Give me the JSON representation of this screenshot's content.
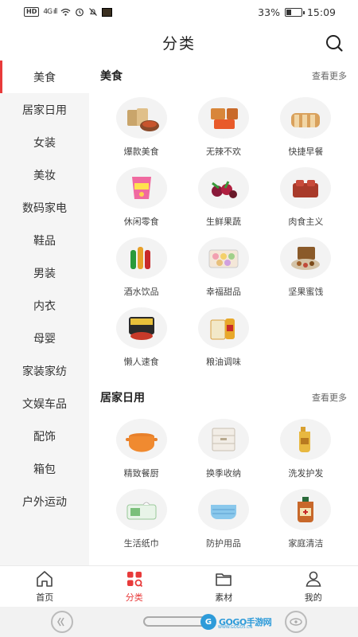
{
  "status_bar": {
    "hd": "HD",
    "signal": "4G ıll",
    "battery_percent": "33%",
    "battery_level": 0.33,
    "time": "15:09"
  },
  "header": {
    "title": "分类",
    "search_icon": "search-icon"
  },
  "sidebar": {
    "items": [
      {
        "label": "美食"
      },
      {
        "label": "居家日用"
      },
      {
        "label": "女装"
      },
      {
        "label": "美妆"
      },
      {
        "label": "数码家电"
      },
      {
        "label": "鞋品"
      },
      {
        "label": "男装"
      },
      {
        "label": "内衣"
      },
      {
        "label": "母婴"
      },
      {
        "label": "家装家纺"
      },
      {
        "label": "文娱车品"
      },
      {
        "label": "配饰"
      },
      {
        "label": "箱包"
      },
      {
        "label": "户外运动"
      }
    ],
    "active_index": 0
  },
  "sections": [
    {
      "title": "美食",
      "more": "查看更多",
      "items": [
        {
          "label": "爆款美食",
          "icon": "snack-food-icon"
        },
        {
          "label": "无辣不欢",
          "icon": "spicy-meat-icon"
        },
        {
          "label": "快捷早餐",
          "icon": "bread-icon"
        },
        {
          "label": "休闲零食",
          "icon": "chips-icon"
        },
        {
          "label": "生鲜果蔬",
          "icon": "fruit-icon"
        },
        {
          "label": "肉食主义",
          "icon": "meat-icon"
        },
        {
          "label": "酒水饮品",
          "icon": "drinks-icon"
        },
        {
          "label": "幸福甜品",
          "icon": "macaron-icon"
        },
        {
          "label": "坚果蜜饯",
          "icon": "nuts-icon"
        },
        {
          "label": "懒人速食",
          "icon": "noodles-icon"
        },
        {
          "label": "粮油调味",
          "icon": "oil-rice-icon"
        }
      ]
    },
    {
      "title": "居家日用",
      "more": "查看更多",
      "items": [
        {
          "label": "精致餐厨",
          "icon": "pot-icon"
        },
        {
          "label": "换季收纳",
          "icon": "storage-box-icon"
        },
        {
          "label": "洗发护发",
          "icon": "shampoo-icon"
        },
        {
          "label": "生活纸巾",
          "icon": "tissue-icon"
        },
        {
          "label": "防护用品",
          "icon": "mask-icon"
        },
        {
          "label": "家庭清洁",
          "icon": "cleaner-bottle-icon"
        }
      ]
    }
  ],
  "tabbar": {
    "tabs": [
      {
        "label": "首页",
        "icon": "home-icon"
      },
      {
        "label": "分类",
        "icon": "category-icon"
      },
      {
        "label": "素材",
        "icon": "folder-icon"
      },
      {
        "label": "我的",
        "icon": "user-icon"
      }
    ],
    "active_index": 1
  },
  "watermark": {
    "logo": "G",
    "text": "GOGO手游网",
    "sub": "WWW.GOGO5.CN"
  },
  "colors": {
    "accent": "#e83a3a",
    "sidebar_bg": "#f5f5f5",
    "watermark": "#2e9bd9"
  }
}
